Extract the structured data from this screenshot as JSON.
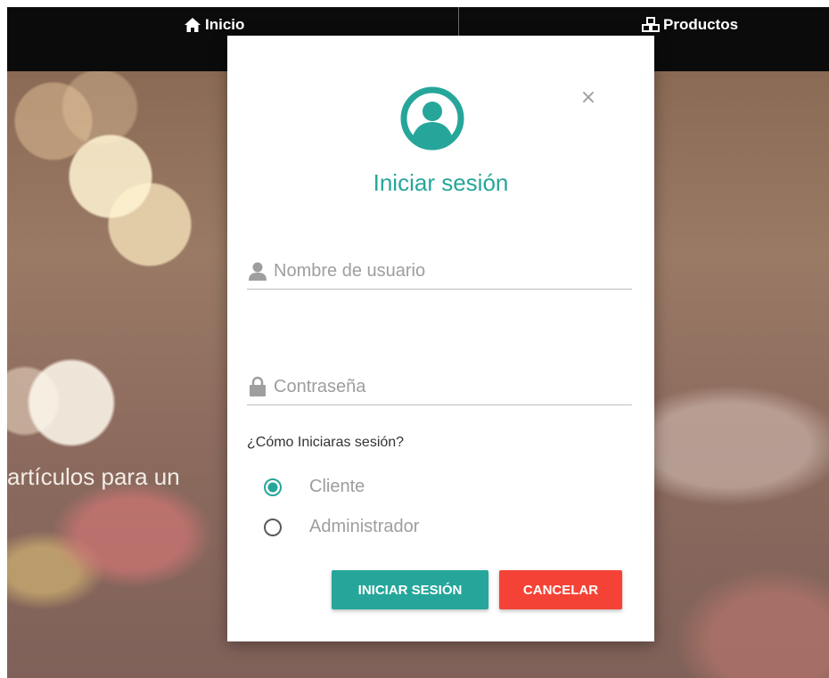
{
  "navbar": {
    "home_label": "Inicio",
    "products_label": "Productos"
  },
  "hero": {
    "text": "artículos para un"
  },
  "modal": {
    "title": "Iniciar sesión",
    "close_label": "×",
    "username": {
      "placeholder": "Nombre de usuario",
      "value": ""
    },
    "password": {
      "placeholder": "Contraseña",
      "value": ""
    },
    "question": "¿Cómo Iniciaras sesión?",
    "options": [
      {
        "label": "Cliente",
        "selected": true
      },
      {
        "label": "Administrador",
        "selected": false
      }
    ],
    "login_button": "INICIAR SESIÓN",
    "cancel_button": "CANCELAR"
  },
  "colors": {
    "accent": "#26a69a",
    "danger": "#f44336",
    "navbar": "#0b0b0b"
  },
  "icons": {
    "home": "home-icon",
    "products": "cubes-icon",
    "avatar": "user-circle-icon",
    "username": "user-icon",
    "password": "lock-icon"
  }
}
